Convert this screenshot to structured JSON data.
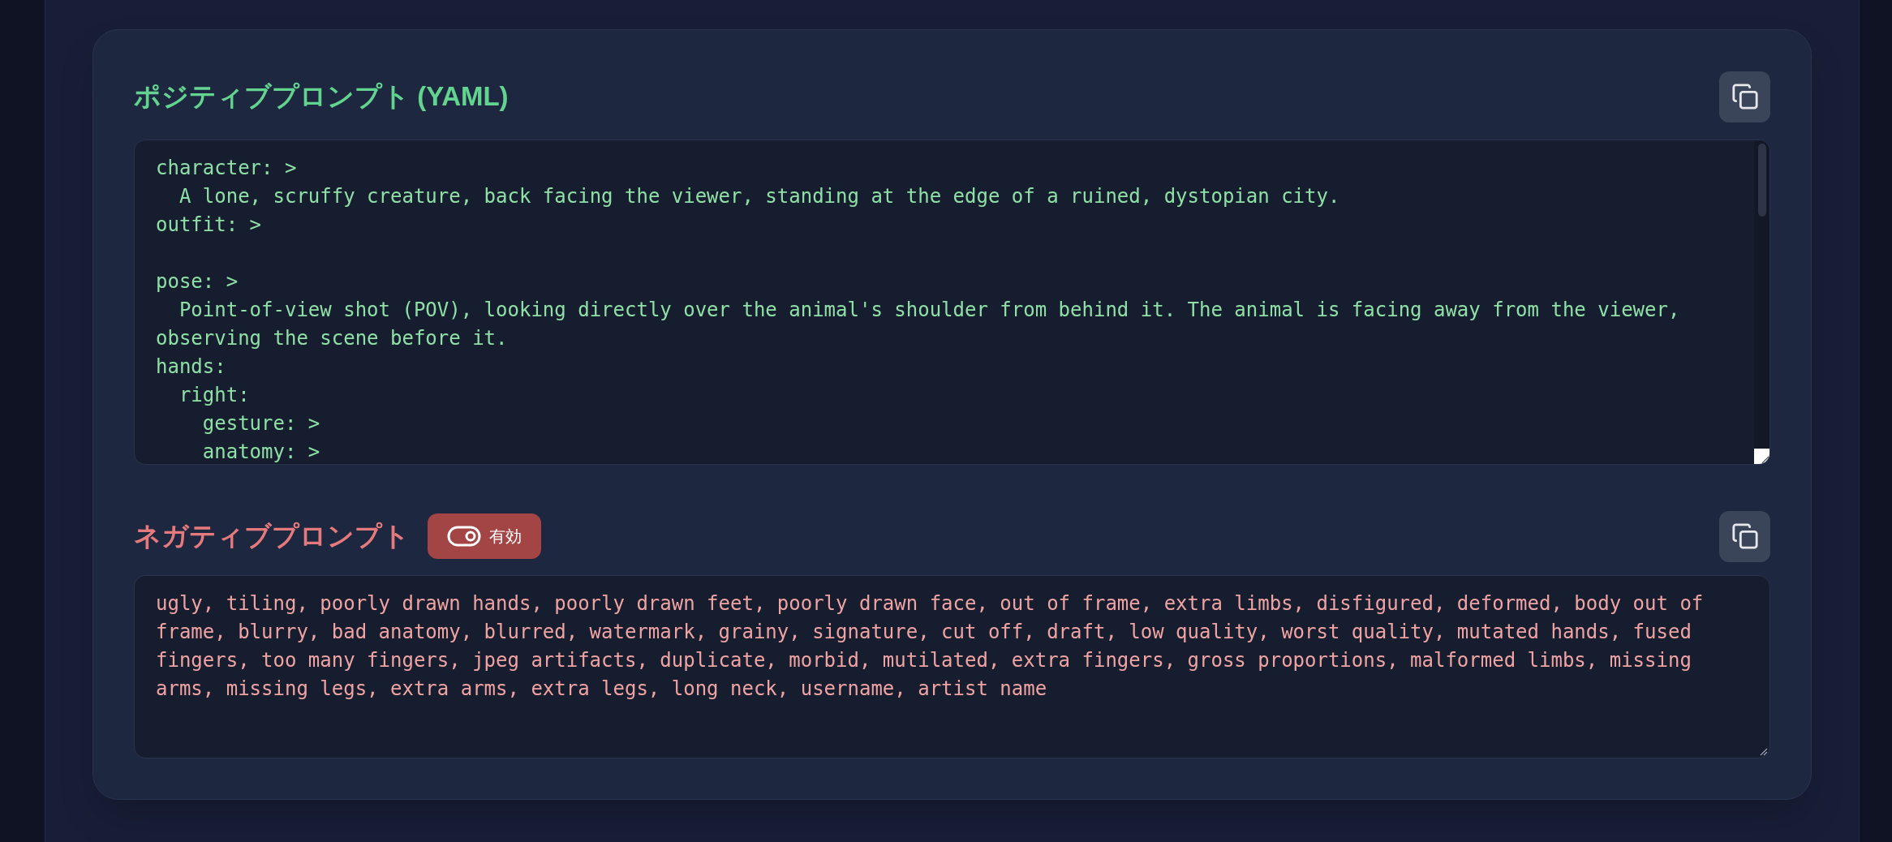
{
  "positive": {
    "title": "ポジティブプロンプト (YAML)",
    "text": "character: >\n  A lone, scruffy creature, back facing the viewer, standing at the edge of a ruined, dystopian city.\noutfit: >\n\npose: >\n  Point-of-view shot (POV), looking directly over the animal's shoulder from behind it. The animal is facing away from the viewer, observing the scene before it.\nhands:\n  right:\n    gesture: >\n    anatomy: >"
  },
  "negative": {
    "title": "ネガティブプロンプト",
    "toggle": {
      "label": "有効",
      "on": true
    },
    "text": "ugly, tiling, poorly drawn hands, poorly drawn feet, poorly drawn face, out of frame, extra limbs, disfigured, deformed, body out of frame, blurry, bad anatomy, blurred, watermark, grainy, signature, cut off, draft, low quality, worst quality, mutated hands, fused fingers, too many fingers, jpeg artifacts, duplicate, morbid, mutilated, extra fingers, gross proportions, malformed limbs, missing arms, missing legs, extra arms, extra legs, long neck, username, artist name"
  }
}
